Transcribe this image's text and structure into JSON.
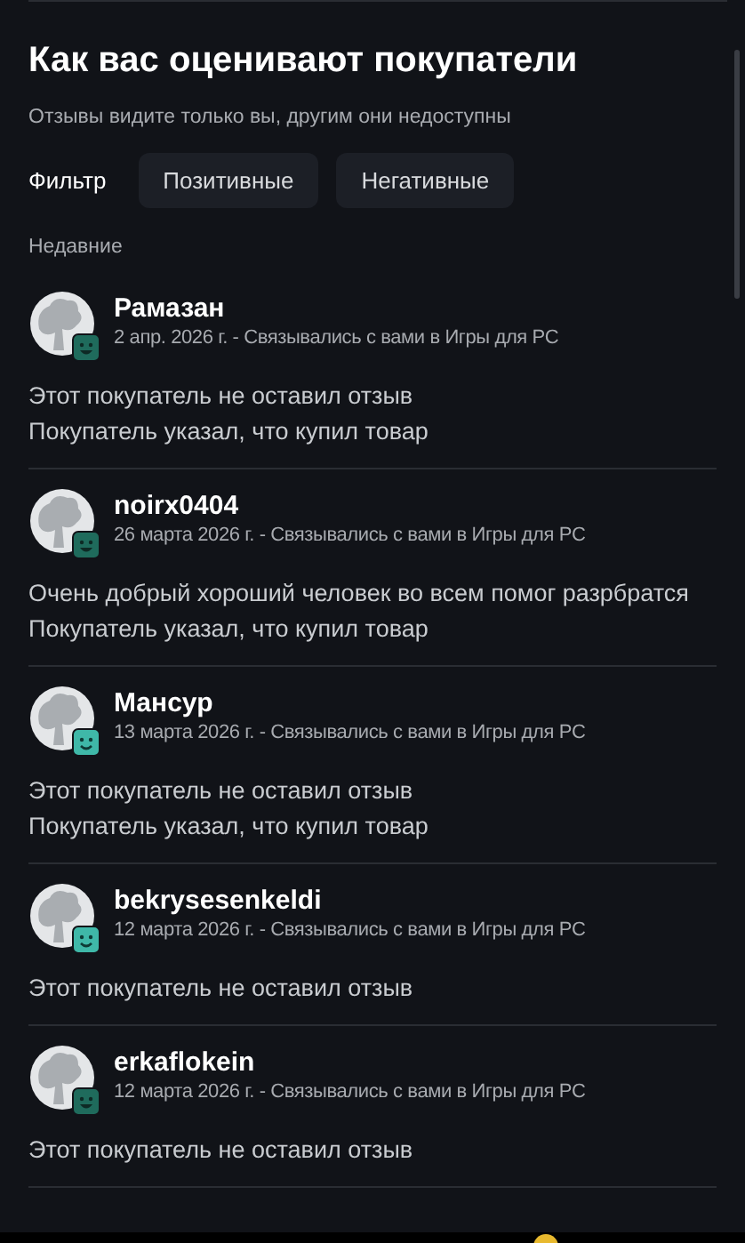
{
  "title": "Как вас оценивают покупатели",
  "subtitle": "Отзывы видите только вы, другим они недоступны",
  "filter": {
    "label": "Фильтр",
    "options": [
      {
        "label": "Позитивные",
        "selected": false
      },
      {
        "label": "Негативные",
        "selected": false
      }
    ]
  },
  "section": "Недавние",
  "reviews": [
    {
      "name": "Рамазан",
      "meta": "2 апр. 2026 г. - Связывались с вами в Игры для PC",
      "badge": {
        "kind": "grin"
      },
      "lines": [
        "Этот покупатель не оставил отзыв",
        "Покупатель указал, что купил товар"
      ]
    },
    {
      "name": "noirx0404",
      "meta": "26 марта 2026 г. - Связывались с вами в Игры для PC",
      "badge": {
        "kind": "grin"
      },
      "lines": [
        "Очень добрый хороший человек во всем помог разрбратся",
        "Покупатель указал, что купил товар"
      ]
    },
    {
      "name": "Мансур",
      "meta": "13 марта 2026 г. - Связывались с вами в Игры для PC",
      "badge": {
        "kind": "smile"
      },
      "lines": [
        "Этот покупатель не оставил отзыв",
        "Покупатель указал, что купил товар"
      ]
    },
    {
      "name": "bekrysesenkeldi",
      "meta": "12 марта 2026 г. - Связывались с вами в Игры для PC",
      "badge": {
        "kind": "smile"
      },
      "lines": [
        "Этот покупатель не оставил отзыв"
      ]
    },
    {
      "name": "erkaflokein",
      "meta": "12 марта 2026 г. - Связывались с вами в Игры для PC",
      "badge": {
        "kind": "grin"
      },
      "lines": [
        "Этот покупатель не оставил отзыв"
      ]
    }
  ]
}
